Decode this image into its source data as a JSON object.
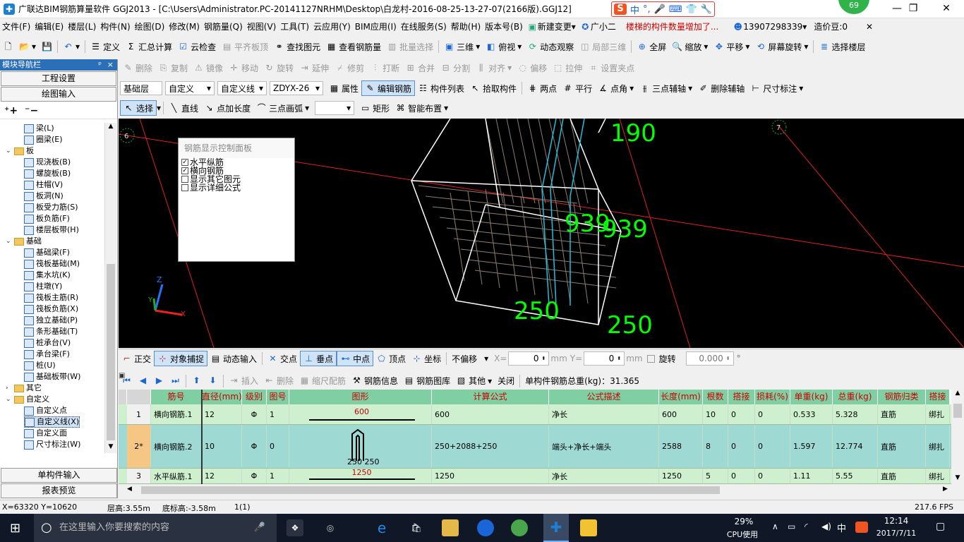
{
  "title": "广联达BIM钢筋算量软件 GGJ2013 - [C:\\Users\\Administrator.PC-20141127NRHM\\Desktop\\白龙村-2016-08-25-13-27-07(2166版).GGJ12]",
  "ime_badge": "69",
  "ime": {
    "s": "S",
    "zh": "中"
  },
  "menu": [
    "文件(F)",
    "编辑(E)",
    "楼层(L)",
    "构件(N)",
    "绘图(D)",
    "修改(M)",
    "钢筋量(Q)",
    "视图(V)",
    "工具(T)",
    "云应用(Y)",
    "BIM应用(I)",
    "在线服务(S)",
    "帮助(H)",
    "版本号(B)",
    "新建变更",
    "广小二"
  ],
  "menu_right": {
    "notice": "楼梯的构件数量增加了...",
    "phone": "13907298339",
    "bean": "造价豆:0"
  },
  "tb1": {
    "define": "定义",
    "sum": "汇总计算",
    "cloud": "云检查",
    "flat": "平齐板顶",
    "find": "查找图元",
    "view_rebar": "查看钢筋量",
    "batch": "批量选择",
    "three_d": "三维",
    "top": "俯视",
    "dynamic": "动态观察",
    "local3d": "局部三维",
    "full": "全屏",
    "zoom": "缩放",
    "pan": "平移",
    "rotate": "屏幕旋转",
    "floor": "选择楼层"
  },
  "tb2": [
    "删除",
    "复制",
    "镜像",
    "移动",
    "旋转",
    "延伸",
    "修剪",
    "打断",
    "合并",
    "分割",
    "对齐",
    "偏移",
    "拉伸",
    "设置夹点"
  ],
  "tb3": {
    "layer": "基础层",
    "custom": "自定义",
    "line_type": "自定义线",
    "code": "ZDYX-26",
    "attr": "属性",
    "edit_rebar": "编辑钢筋",
    "list": "构件列表",
    "pick": "拾取构件",
    "two_pt": "两点",
    "parallel": "平行",
    "angle": "点角",
    "three_pt": "三点辅轴",
    "del_axis": "删除辅轴",
    "dim": "尺寸标注"
  },
  "tb4": {
    "select": "选择",
    "line": "直线",
    "add_len": "点加长度",
    "arc": "三点画弧",
    "rect": "矩形",
    "smart": "智能布置"
  },
  "nav": {
    "header": "模块导航栏",
    "pin": "ᵖ",
    "close": "×",
    "btn1": "工程设置",
    "btn2": "绘图输入",
    "btn3": "单构件输入",
    "btn4": "报表预览"
  },
  "tree": [
    {
      "label": "梁(L)",
      "lvl": 3
    },
    {
      "label": "圈梁(E)",
      "lvl": 3
    },
    {
      "label": "板",
      "lvl": 1,
      "folder": true
    },
    {
      "label": "现浇板(B)",
      "lvl": 3
    },
    {
      "label": "螺旋板(B)",
      "lvl": 3
    },
    {
      "label": "柱帽(V)",
      "lvl": 3
    },
    {
      "label": "板洞(N)",
      "lvl": 3
    },
    {
      "label": "板受力筋(S)",
      "lvl": 3
    },
    {
      "label": "板负筋(F)",
      "lvl": 3
    },
    {
      "label": "楼层板带(H)",
      "lvl": 3
    },
    {
      "label": "基础",
      "lvl": 1,
      "folder": true
    },
    {
      "label": "基础梁(F)",
      "lvl": 3
    },
    {
      "label": "筏板基础(M)",
      "lvl": 3
    },
    {
      "label": "集水坑(K)",
      "lvl": 3
    },
    {
      "label": "柱墩(Y)",
      "lvl": 3
    },
    {
      "label": "筏板主筋(R)",
      "lvl": 3
    },
    {
      "label": "筏板负筋(X)",
      "lvl": 3
    },
    {
      "label": "独立基础(P)",
      "lvl": 3
    },
    {
      "label": "条形基础(T)",
      "lvl": 3
    },
    {
      "label": "桩承台(V)",
      "lvl": 3
    },
    {
      "label": "承台梁(F)",
      "lvl": 3
    },
    {
      "label": "桩(U)",
      "lvl": 3
    },
    {
      "label": "基础板带(W)",
      "lvl": 3
    },
    {
      "label": "其它",
      "lvl": 1,
      "folder": true,
      "collapsed": true
    },
    {
      "label": "自定义",
      "lvl": 1,
      "folder": true
    },
    {
      "label": "自定义点",
      "lvl": 3
    },
    {
      "label": "自定义线(X)",
      "lvl": 3,
      "selected": true
    },
    {
      "label": "自定义面",
      "lvl": 3
    },
    {
      "label": "尺寸标注(W)",
      "lvl": 3
    }
  ],
  "viewport": {
    "axis_left": "6",
    "axis_right": "7",
    "dims": [
      "190",
      "939",
      "939",
      "250",
      "250"
    ],
    "axes": {
      "z": "Z",
      "y": "Y",
      "x": "X"
    }
  },
  "panel": {
    "title": "钢筋显示控制面板",
    "items": [
      {
        "label": "水平纵筋",
        "checked": true
      },
      {
        "label": "横向钢筋",
        "checked": true
      },
      {
        "label": "显示其它图元",
        "checked": false
      },
      {
        "label": "显示详细公式",
        "checked": false
      }
    ]
  },
  "snap": {
    "ortho": "正交",
    "snap": "对象捕捉",
    "dyn": "动态输入",
    "inter": "交点",
    "mid_v": "垂点",
    "mid": "中点",
    "vertex": "顶点",
    "coord": "坐标",
    "offset": "不偏移",
    "x_label": "X=",
    "x_val": "0",
    "mm1": "mm",
    "y_label": "Y=",
    "y_val": "0",
    "mm2": "mm",
    "rotate": "旋转",
    "rotate_val": "0.000",
    "deg": "°"
  },
  "gridtb": {
    "insert": "插入",
    "delete": "删除",
    "scale": "缩尺配筋",
    "info": "钢筋信息",
    "lib": "钢筋图库",
    "other": "其他",
    "close": "关闭",
    "total": "单构件钢筋总重(kg)：31.365"
  },
  "grid": {
    "headers": [
      "筋号",
      "直径(mm)",
      "级别",
      "图号",
      "图形",
      "计算公式",
      "公式描述",
      "长度(mm)",
      "根数",
      "搭接",
      "损耗(%)",
      "单重(kg)",
      "总重(kg)",
      "钢筋归类",
      "搭接"
    ],
    "rows": [
      {
        "n": "1",
        "name": "横向钢筋.1",
        "dia": "12",
        "grade": "Φ",
        "fig": "1",
        "shape_txt": "600",
        "formula": "600",
        "desc": "净长",
        "len": "600",
        "cnt": "10",
        "lap": "0",
        "loss": "0",
        "unit": "0.533",
        "total": "5.328",
        "cat": "直筋",
        "lap2": "绑扎"
      },
      {
        "n": "2*",
        "name": "横向钢筋.2",
        "dia": "10",
        "grade": "Φ",
        "fig": "0",
        "shape_txt": "250 250",
        "formula": "250+2088+250",
        "desc": "端头+净长+端头",
        "len": "2588",
        "cnt": "8",
        "lap": "0",
        "loss": "0",
        "unit": "1.597",
        "total": "12.774",
        "cat": "直筋",
        "lap2": "绑扎"
      },
      {
        "n": "3",
        "name": "水平纵筋.1",
        "dia": "12",
        "grade": "Φ",
        "fig": "1",
        "shape_txt": "1250",
        "formula": "1250",
        "desc": "净长",
        "len": "1250",
        "cnt": "5",
        "lap": "0",
        "loss": "0",
        "unit": "1.11",
        "total": "5.55",
        "cat": "直筋",
        "lap2": "绑扎"
      }
    ]
  },
  "status": {
    "coord": "X=63320 Y=10620",
    "floor_h": "层高:3.55m",
    "bottom_h": "底标高:-3.58m",
    "num": "1(1)",
    "fps": "217.6 FPS"
  },
  "taskbar": {
    "search": "在这里输入你要搜索的内容",
    "cpu_pct": "29%",
    "cpu_label": "CPU使用",
    "lang": "中",
    "time": "12:14",
    "date": "2017/7/11"
  }
}
